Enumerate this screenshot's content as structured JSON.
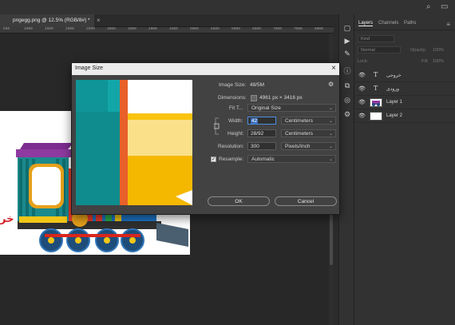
{
  "document": {
    "tab_title": "pngegg.png @ 12.5% (RGB/8#) *",
    "tab_close": "×",
    "ruler_ticks": [
      "550",
      "1000",
      "1500",
      "2000",
      "2500",
      "3000",
      "3500",
      "4000",
      "4500",
      "5000",
      "5500",
      "6000",
      "6500",
      "7000",
      "7500",
      "8000",
      "8500"
    ],
    "image_text": "خر"
  },
  "top_bar": {
    "search_glyph": "⌕",
    "window_glyph": "▭"
  },
  "tools": {
    "glyphs": [
      "▶",
      "ⓘ",
      "⧉",
      "◎",
      "⚙"
    ]
  },
  "layers_panel": {
    "tabs": [
      "Layers",
      "Channels",
      "Paths"
    ],
    "menu": "≡",
    "kind_placeholder": "Kind",
    "blend_mode": "Normal",
    "opacity_label": "Opacity:",
    "opacity_value": "100%",
    "lock_label": "Lock:",
    "fill_label": "Fill:",
    "fill_value": "100%",
    "layers": [
      {
        "name": "خروجی",
        "kind": "text",
        "glyph": "T",
        "visible": "👁"
      },
      {
        "name": "ورودی",
        "kind": "text",
        "glyph": "T",
        "visible": "👁"
      },
      {
        "name": "Layer 1",
        "kind": "image",
        "glyph": "",
        "visible": "👁"
      },
      {
        "name": "Layer 2",
        "kind": "image",
        "glyph": "",
        "visible": "👁"
      }
    ]
  },
  "dialog": {
    "title": "Image Size",
    "close": "×",
    "image_size_label": "Image Size:",
    "image_size_value": "48/5M",
    "gear": "⚙",
    "dimensions_label": "Dimensions:",
    "dimensions_value": "4961 px  ×  3416 px",
    "fit_to_label": "Fit T...",
    "fit_to_value": "Original Size",
    "width_label": "Width:",
    "width_value": "42",
    "width_unit": "Centimeters",
    "height_label": "Height:",
    "height_value": "28/92",
    "height_unit": "Centimeters",
    "resolution_label": "Resolution:",
    "resolution_value": "300",
    "resolution_unit": "Pixels/Inch",
    "resample_label": "Resample:",
    "resample_checked": "✓",
    "resample_value": "Automatic",
    "ok_label": "OK",
    "cancel_label": "Cancel",
    "caret": "⌄"
  }
}
